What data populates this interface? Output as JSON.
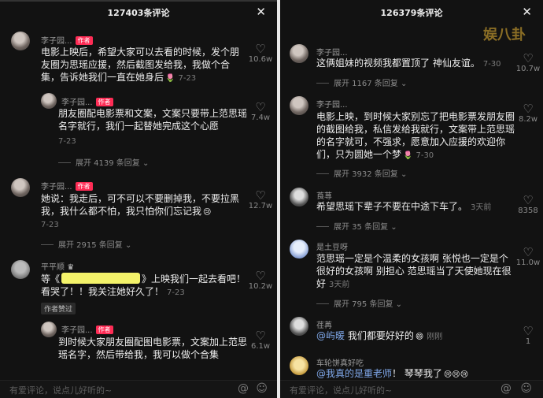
{
  "left": {
    "title": "127403条评论",
    "comments": [
      {
        "user": "李子园...",
        "badge": "作者",
        "text": "电影上映后，希望大家可以去看的时候，发个朋友圈为思瑶应援，然后截图发给我，我做个合集，告诉她我们一直在她身后",
        "emoji": "🌷",
        "time": "7-23",
        "likes": "10.6w"
      },
      {
        "user": "李子园...",
        "badge": "作者",
        "text": "朋友圈配电影票和文案，文案只要带上范思瑶名字就行，我们一起替她完成这个心愿",
        "time": "7-23",
        "likes": "7.4w",
        "expand": "展开 4139 条回复"
      },
      {
        "user": "李子园...",
        "badge": "作者",
        "text": "她说：我走后，可不可以不要删掉我，不要拉黑我，我什么都不怕，我只怕你们忘记我",
        "emoji": "😢",
        "time": "7-23",
        "likes": "12.7w",
        "expand": "展开 2915 条回复"
      },
      {
        "user": "平平顺",
        "text_before": "等《",
        "text_after": "》上映我们一起去看吧！看哭了！！我关注她好久了！",
        "time": "7-23",
        "likes": "10.2w",
        "tag": "作者赞过"
      },
      {
        "user": "李子园...",
        "badge": "作者",
        "text": "到时候大家朋友圈配图电影票，文案加上范思瑶名字，然后带给我，我可以做个合集",
        "likes": "6.1w"
      }
    ],
    "input_placeholder": "有爱评论，说点儿好听的~"
  },
  "right": {
    "title": "126379条评论",
    "watermark": "娱八卦",
    "comments": [
      {
        "user": "李子园...",
        "text": "这俩姐妹的视频我都置顶了 神仙友谊。",
        "time": "7-30",
        "likes": "10.7w",
        "expand": "展开 1167 条回复"
      },
      {
        "user": "李子园...",
        "text": "电影上映，到时候大家别忘了把电影票发朋友圈的截图给我，私信发给我就行，文案带上范思瑶的名字就可，不强求，愿意加入应援的欢迎你们，只为圆她一个梦",
        "emoji": "🌷",
        "time": "7-30",
        "likes": "8.2w",
        "expand": "展开 3932 条回复"
      },
      {
        "user": "莨荨",
        "text": "希望思瑶下辈子不要在中途下车了。",
        "time": "3天前",
        "likes": "8358",
        "expand": "展开 35 条回复"
      },
      {
        "user": "是土豆呀",
        "text": "范思瑶一定是个温柔的女孩啊 张悦也一定是个很好的女孩啊 别担心 范思瑶当了天使她现在很好",
        "time": "3天前",
        "likes": "11.0w",
        "expand": "展开 795 条回复"
      },
      {
        "user": "荏苒",
        "mention": "@屿暖",
        "text": "我们都要好好的",
        "emoji": "😄",
        "time": "刚刚",
        "likes": "1"
      },
      {
        "user": "车轮饼真好吃",
        "mention": "@我真的是重老师",
        "text": "！ 琴琴我了",
        "emoji": "😢😢😢"
      }
    ],
    "input_placeholder": "有爱评论，说点儿好听的~"
  }
}
